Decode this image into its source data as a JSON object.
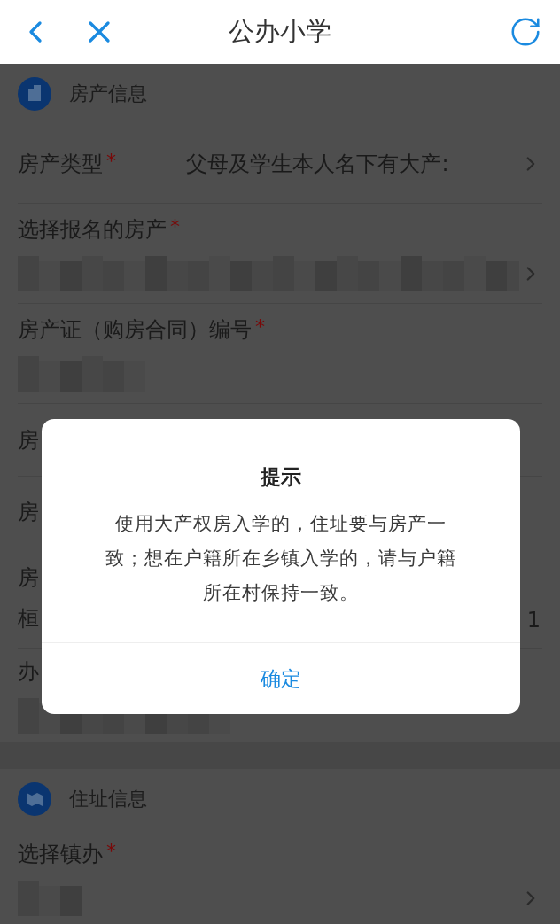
{
  "nav": {
    "title": "公办小学"
  },
  "sections": [
    {
      "title": "房产信息",
      "rows": [
        {
          "kind": "inline",
          "label": "房产类型",
          "mark": "*",
          "value": "父母及学生本人名下有大产:",
          "chevron": true,
          "masked": false
        },
        {
          "kind": "stacked",
          "label": "选择报名的房产",
          "mark": "*",
          "chevron": true,
          "masked": true
        },
        {
          "kind": "stacked",
          "label": "房产证（购房合同）编号",
          "mark": "*",
          "chevron": false,
          "masked": true
        },
        {
          "kind": "stacked",
          "label": "房",
          "chevron": false,
          "masked": false
        },
        {
          "kind": "stacked",
          "label": "房",
          "chevron": false,
          "masked": false
        },
        {
          "kind": "stacked",
          "label": "房",
          "chevron": false,
          "masked": false,
          "value": "桓",
          "trailing": "1"
        },
        {
          "kind": "stacked",
          "label": "办",
          "chevron": false,
          "masked": true
        }
      ]
    },
    {
      "title": "住址信息",
      "rows": [
        {
          "kind": "stacked",
          "label": "选择镇办",
          "mark": "*",
          "chevron": true,
          "masked": true
        }
      ]
    }
  ],
  "dialog": {
    "title": "提示",
    "message_lines": [
      "使用大产权房入学的，住址要与房产一",
      "致；想在户籍所在乡镇入学的，请与户籍",
      "所在村保持一致。"
    ],
    "button": "确定"
  }
}
